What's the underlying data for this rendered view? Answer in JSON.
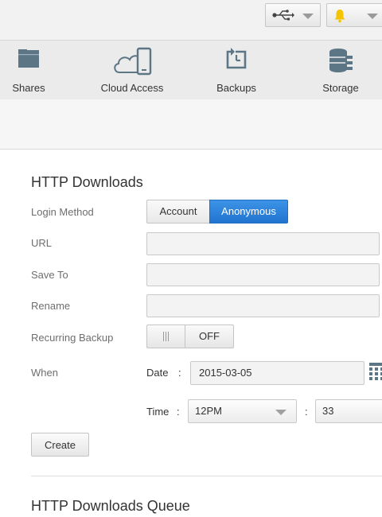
{
  "topbar": {
    "usb_icon": "usb-icon",
    "bell_icon": "bell-icon",
    "bell_color": "#f5c400"
  },
  "nav": {
    "items": [
      {
        "label": "Shares",
        "icon": "folder-icon"
      },
      {
        "label": "Cloud Access",
        "icon": "cloud-device-icon"
      },
      {
        "label": "Backups",
        "icon": "backup-icon"
      },
      {
        "label": "Storage",
        "icon": "storage-icon"
      }
    ]
  },
  "http_downloads": {
    "title": "HTTP Downloads",
    "login_method": {
      "label": "Login Method",
      "options": [
        "Account",
        "Anonymous"
      ],
      "selected": "Anonymous"
    },
    "url": {
      "label": "URL",
      "value": ""
    },
    "save_to": {
      "label": "Save To",
      "value": ""
    },
    "rename": {
      "label": "Rename",
      "value": ""
    },
    "recurring_backup": {
      "label": "Recurring Backup",
      "state": "OFF"
    },
    "when": {
      "label": "When",
      "date_label": "Date",
      "colon": ":",
      "date_value": "2015-03-05",
      "time_label": "Time",
      "hour": "12PM",
      "minute": "33"
    },
    "create_label": "Create"
  },
  "queue": {
    "title": "HTTP Downloads Queue"
  },
  "colors": {
    "accent": "#2a7fd9",
    "nav_bg": "#ebebeb",
    "icon_slate": "#5c7686"
  }
}
